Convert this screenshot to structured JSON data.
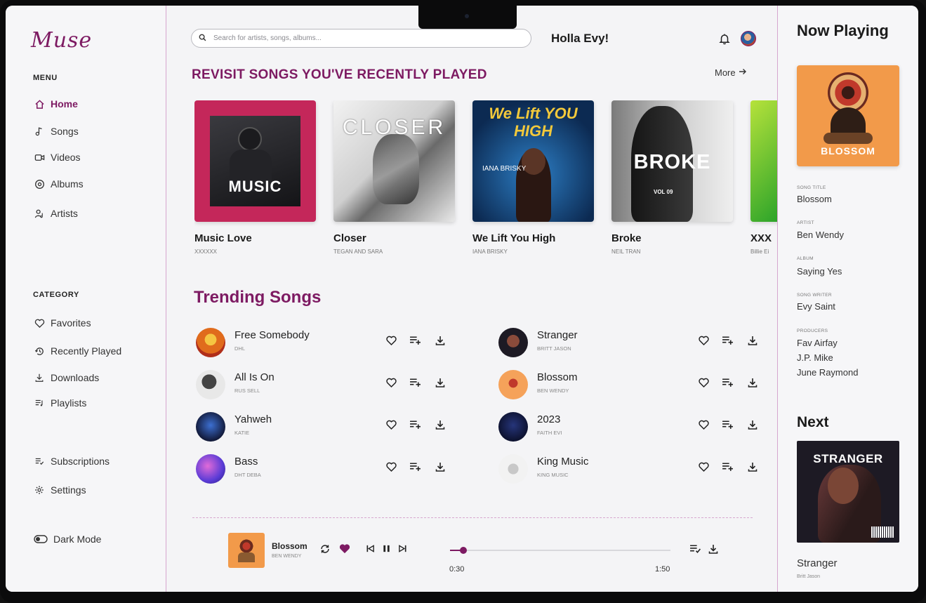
{
  "app": {
    "logo": "Muse"
  },
  "sidebar": {
    "menu_label": "MENU",
    "menu": [
      {
        "label": "Home",
        "icon": "home-icon",
        "active": true
      },
      {
        "label": "Songs",
        "icon": "music-note-icon"
      },
      {
        "label": "Videos",
        "icon": "video-icon"
      },
      {
        "label": "Albums",
        "icon": "album-icon"
      },
      {
        "label": "Artists",
        "icon": "artists-icon"
      }
    ],
    "category_label": "CATEGORY",
    "categories": [
      {
        "label": "Favorites",
        "icon": "heart-icon"
      },
      {
        "label": "Recently Played",
        "icon": "history-icon"
      },
      {
        "label": "Downloads",
        "icon": "download-icon"
      },
      {
        "label": "Playlists",
        "icon": "playlist-icon"
      }
    ],
    "extra": [
      {
        "label": "Subscriptions",
        "icon": "subscriptions-icon"
      },
      {
        "label": "Settings",
        "icon": "gear-icon"
      }
    ],
    "dark_mode_label": "Dark Mode"
  },
  "header": {
    "search_placeholder": "Search for artists, songs, albums...",
    "greeting": "Holla Evy!"
  },
  "recent": {
    "title": "REVISIT SONGS YOU'VE RECENTLY PLAYED",
    "more_label": "More",
    "cards": [
      {
        "title": "Music Love",
        "artist": "XXXXXX",
        "cover_text": "MUSIC"
      },
      {
        "title": "Closer",
        "artist": "TEGAN AND SARA",
        "cover_text": "CLOSER"
      },
      {
        "title": "We Lift You High",
        "artist": "IANA BRISKY",
        "cover_text": "We Lift YOU HIGH",
        "cover_sub": "IANA BRISKY"
      },
      {
        "title": "Broke",
        "artist": "NEIL TRAN",
        "cover_text": "BROKE",
        "cover_sub": "VOL 09"
      },
      {
        "title": "XXX",
        "artist": "Billie Ei"
      }
    ]
  },
  "trending": {
    "title": "Trending Songs",
    "left": [
      {
        "name": "Free Somebody",
        "artist": "DHL"
      },
      {
        "name": "All Is On",
        "artist": "RUS SELL"
      },
      {
        "name": "Yahweh",
        "artist": "KATIE"
      },
      {
        "name": "Bass",
        "artist": "DHT DEBA"
      }
    ],
    "right": [
      {
        "name": "Stranger",
        "artist": "BRITT JASON"
      },
      {
        "name": "Blossom",
        "artist": "BEN WENDY"
      },
      {
        "name": "2023",
        "artist": "FAITH EVI"
      },
      {
        "name": "King Music",
        "artist": "KING MUSIC"
      }
    ]
  },
  "player": {
    "title": "Blossom",
    "artist": "BEN WENDY",
    "elapsed": "0:30",
    "duration": "1:50",
    "progress": 0.06
  },
  "now_playing": {
    "title": "Now Playing",
    "cover_text": "BLOSSOM",
    "fields": [
      {
        "label": "SONG TITLE",
        "values": [
          "Blossom"
        ]
      },
      {
        "label": "ARTIST",
        "values": [
          "Ben Wendy"
        ]
      },
      {
        "label": "ALBUM",
        "values": [
          "Saying Yes"
        ]
      },
      {
        "label": "SONG WRITER",
        "values": [
          "Evy Saint"
        ]
      },
      {
        "label": "PRODUCERS",
        "values": [
          "Fav Airfay",
          "J.P. Mike",
          "June Raymond"
        ]
      }
    ]
  },
  "next": {
    "title": "Next",
    "cover_text": "STRANGER",
    "name": "Stranger",
    "artist": "Britt Jason"
  },
  "colors": {
    "accent": "#7d1a62",
    "divider": "#d6a6cf"
  }
}
